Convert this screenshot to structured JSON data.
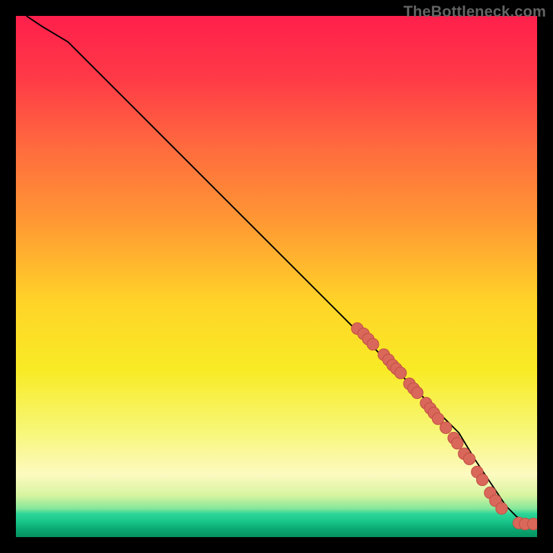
{
  "watermark": "TheBottleneck.com",
  "colors": {
    "marker_fill": "#d9675a",
    "marker_stroke": "#c24e43",
    "curve": "#000000",
    "frame_bg": "#000000"
  },
  "gradient_stops": [
    {
      "offset": 0.0,
      "color": "#ff1f4b"
    },
    {
      "offset": 0.12,
      "color": "#ff3a47"
    },
    {
      "offset": 0.25,
      "color": "#ff6a3e"
    },
    {
      "offset": 0.4,
      "color": "#ff9a33"
    },
    {
      "offset": 0.55,
      "color": "#ffd428"
    },
    {
      "offset": 0.68,
      "color": "#f8eb25"
    },
    {
      "offset": 0.8,
      "color": "#f7f77a"
    },
    {
      "offset": 0.88,
      "color": "#fdfac0"
    },
    {
      "offset": 0.92,
      "color": "#d7f4a0"
    },
    {
      "offset": 0.945,
      "color": "#86e79a"
    },
    {
      "offset": 0.955,
      "color": "#2ed698"
    },
    {
      "offset": 0.97,
      "color": "#18c68a"
    },
    {
      "offset": 0.985,
      "color": "#0aa772"
    },
    {
      "offset": 1.0,
      "color": "#04915f"
    }
  ],
  "chart_data": {
    "type": "line",
    "title": "",
    "xlabel": "",
    "ylabel": "",
    "xlim": [
      0,
      100
    ],
    "ylim": [
      0,
      100
    ],
    "legend": false,
    "grid": false,
    "series": [
      {
        "name": "curve",
        "kind": "line",
        "x": [
          2,
          5,
          10,
          20,
          30,
          40,
          50,
          60,
          65,
          70,
          75,
          80,
          85,
          88,
          90,
          92,
          94,
          95,
          96,
          97,
          98,
          99,
          100
        ],
        "y": [
          100,
          98,
          95,
          85,
          75,
          65,
          55,
          45,
          40,
          35,
          30,
          25,
          20,
          15,
          12,
          9,
          6,
          5,
          4,
          3.3,
          2.7,
          2.5,
          2.5
        ]
      },
      {
        "name": "markers",
        "kind": "scatter",
        "points": [
          {
            "x": 65.5,
            "y": 40.0
          },
          {
            "x": 66.7,
            "y": 39.0
          },
          {
            "x": 67.6,
            "y": 38.0
          },
          {
            "x": 68.5,
            "y": 37.0
          },
          {
            "x": 70.6,
            "y": 35.0
          },
          {
            "x": 71.5,
            "y": 34.0
          },
          {
            "x": 72.3,
            "y": 33.0
          },
          {
            "x": 73.0,
            "y": 32.3
          },
          {
            "x": 73.8,
            "y": 31.5
          },
          {
            "x": 75.5,
            "y": 29.4
          },
          {
            "x": 76.3,
            "y": 28.5
          },
          {
            "x": 77.0,
            "y": 27.7
          },
          {
            "x": 78.7,
            "y": 25.7
          },
          {
            "x": 79.5,
            "y": 24.7
          },
          {
            "x": 80.2,
            "y": 23.8
          },
          {
            "x": 81.0,
            "y": 22.7
          },
          {
            "x": 82.5,
            "y": 21.0
          },
          {
            "x": 84.0,
            "y": 19.0
          },
          {
            "x": 84.7,
            "y": 18.0
          },
          {
            "x": 86.0,
            "y": 16.0
          },
          {
            "x": 87.0,
            "y": 15.0
          },
          {
            "x": 88.5,
            "y": 12.5
          },
          {
            "x": 89.5,
            "y": 11.0
          },
          {
            "x": 91.0,
            "y": 8.5
          },
          {
            "x": 92.0,
            "y": 7.0
          },
          {
            "x": 93.2,
            "y": 5.5
          },
          {
            "x": 96.5,
            "y": 2.7
          },
          {
            "x": 97.7,
            "y": 2.5
          },
          {
            "x": 99.3,
            "y": 2.5
          }
        ]
      }
    ]
  }
}
